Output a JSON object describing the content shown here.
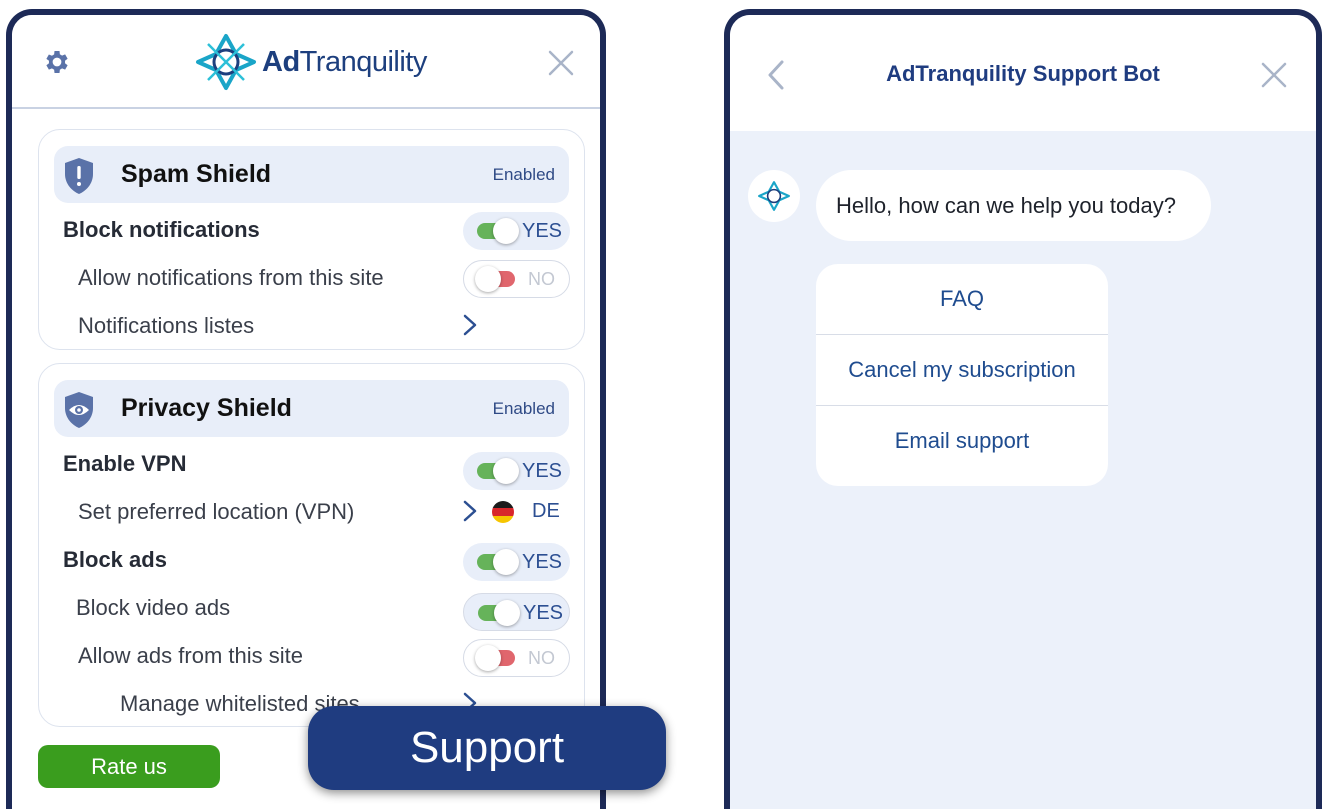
{
  "popup": {
    "brand": {
      "bold": "Ad",
      "rest": "Tranquility"
    },
    "spam_shield": {
      "title": "Spam Shield",
      "status": "Enabled",
      "rows": {
        "block_notifications": {
          "label": "Block notifications",
          "toggle": "YES"
        },
        "allow_notifications": {
          "label": "Allow notifications from this site",
          "toggle": "NO"
        },
        "notifications_list": {
          "label": "Notifications listes"
        }
      }
    },
    "privacy_shield": {
      "title": "Privacy Shield",
      "status": "Enabled",
      "rows": {
        "enable_vpn": {
          "label": "Enable VPN",
          "toggle": "YES"
        },
        "preferred_location": {
          "label": "Set preferred location (VPN)",
          "country": "DE"
        },
        "block_ads": {
          "label": "Block ads",
          "toggle": "YES"
        },
        "block_video_ads": {
          "label": "Block video ads",
          "toggle": "YES"
        },
        "allow_ads": {
          "label": "Allow ads from this site",
          "toggle": "NO"
        },
        "manage_whitelist": {
          "label": "Manage whitelisted sites"
        }
      }
    },
    "rate_button": "Rate us"
  },
  "support_button": "Support",
  "chat": {
    "title": "AdTranquility Support Bot",
    "greeting": "Hello, how can we help you today?",
    "options": [
      "FAQ",
      "Cancel my subscription",
      "Email support"
    ]
  },
  "colors": {
    "navy": "#1d2a57",
    "accent_blue": "#1f3c80",
    "toggle_on": "#66b35a",
    "toggle_off": "#e0666d",
    "rate_green": "#3a9d1e",
    "chat_bg": "#ecf1fa"
  },
  "icons": [
    "gear-icon",
    "close-icon",
    "shield-alert-icon",
    "shield-eye-icon",
    "chevron-right-icon",
    "chevron-left-icon",
    "germany-flag-icon",
    "bot-avatar-icon"
  ]
}
